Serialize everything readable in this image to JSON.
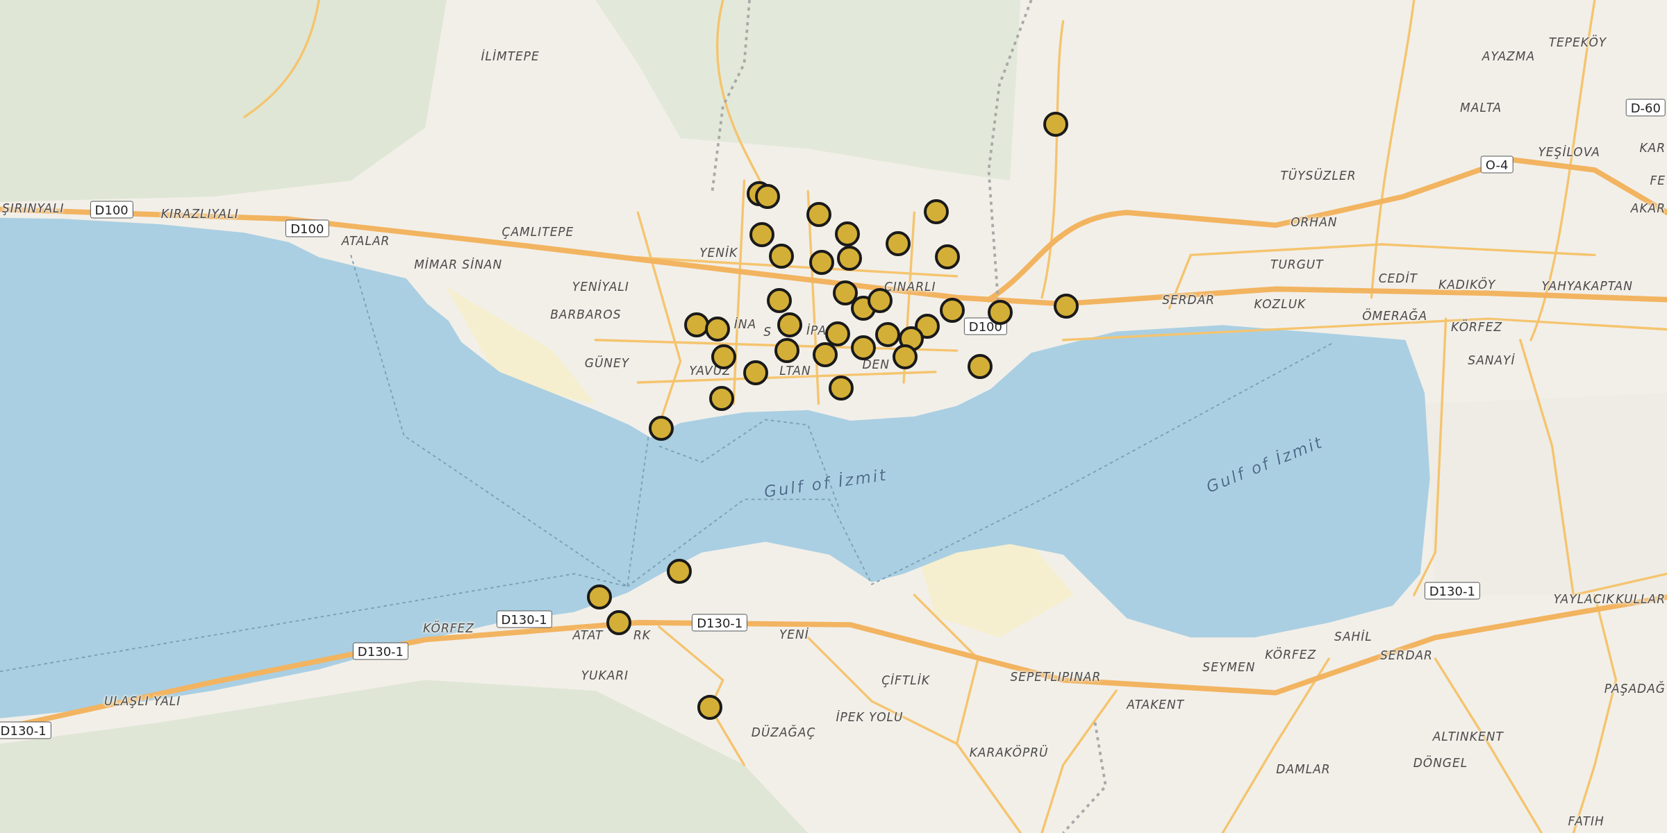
{
  "map": {
    "labels": [
      {
        "text": "İLİMTEPE",
        "kind": "place"
      },
      {
        "text": "AYAZMA",
        "kind": "place"
      },
      {
        "text": "TEPEKÖY",
        "kind": "place"
      },
      {
        "text": "MALTA",
        "kind": "place"
      },
      {
        "text": "D-60",
        "kind": "road_shield"
      },
      {
        "text": "TÜYSÜZLER",
        "kind": "place"
      },
      {
        "text": "O-4",
        "kind": "road_shield"
      },
      {
        "text": "YEŞİLOVA",
        "kind": "place"
      },
      {
        "text": "KAR",
        "kind": "place"
      },
      {
        "text": "FE",
        "kind": "place"
      },
      {
        "text": "ŞIRINYALI",
        "kind": "place"
      },
      {
        "text": "D100",
        "kind": "road_shield"
      },
      {
        "text": "KIRAZLIYALI",
        "kind": "place"
      },
      {
        "text": "AKAR",
        "kind": "place"
      },
      {
        "text": "D100",
        "kind": "road_shield"
      },
      {
        "text": "ATALAR",
        "kind": "place"
      },
      {
        "text": "ÇAMLITEPE",
        "kind": "place"
      },
      {
        "text": "ORHAN",
        "kind": "place"
      },
      {
        "text": "MİMAR SİNAN",
        "kind": "place"
      },
      {
        "text": "YENİK",
        "kind": "place"
      },
      {
        "text": "TURGUT",
        "kind": "place"
      },
      {
        "text": "YENİYALI",
        "kind": "place"
      },
      {
        "text": "ÇINARLI",
        "kind": "place"
      },
      {
        "text": "CEDİT",
        "kind": "place"
      },
      {
        "text": "KADIKÖY",
        "kind": "place"
      },
      {
        "text": "YAHYAKAPTAN",
        "kind": "place"
      },
      {
        "text": "BARBAROS",
        "kind": "place"
      },
      {
        "text": "İNA",
        "kind": "place"
      },
      {
        "text": "S",
        "kind": "place"
      },
      {
        "text": "İPA",
        "kind": "place"
      },
      {
        "text": "D100",
        "kind": "road_shield"
      },
      {
        "text": "SERDAR",
        "kind": "place"
      },
      {
        "text": "KOZLUK",
        "kind": "place"
      },
      {
        "text": "ÖMERAĞA",
        "kind": "place"
      },
      {
        "text": "KÖRFEZ",
        "kind": "place"
      },
      {
        "text": "GÜNEY",
        "kind": "place"
      },
      {
        "text": "YAVUZ",
        "kind": "place"
      },
      {
        "text": "LTAN",
        "kind": "place"
      },
      {
        "text": "DEN",
        "kind": "place"
      },
      {
        "text": "SANAYİ",
        "kind": "place"
      },
      {
        "text": "Gulf of İzmit",
        "kind": "water"
      },
      {
        "text": "Gulf of İzmit",
        "kind": "water"
      },
      {
        "text": "D130-1",
        "kind": "road_shield"
      },
      {
        "text": "YAYLACIK",
        "kind": "place"
      },
      {
        "text": "KULLAR",
        "kind": "place"
      },
      {
        "text": "KÖRFEZ",
        "kind": "place"
      },
      {
        "text": "D130-1",
        "kind": "road_shield"
      },
      {
        "text": "ATAT",
        "kind": "place"
      },
      {
        "text": "RK",
        "kind": "place"
      },
      {
        "text": "D130-1",
        "kind": "road_shield"
      },
      {
        "text": "YENİ",
        "kind": "place"
      },
      {
        "text": "SAHİL",
        "kind": "place"
      },
      {
        "text": "D130-1",
        "kind": "road_shield"
      },
      {
        "text": "KÖRFEZ",
        "kind": "place"
      },
      {
        "text": "SERDAR",
        "kind": "place"
      },
      {
        "text": "YUKARI",
        "kind": "place"
      },
      {
        "text": "ÇİFTLİK",
        "kind": "place"
      },
      {
        "text": "SEPETLIPINAR",
        "kind": "place"
      },
      {
        "text": "SEYMEN",
        "kind": "place"
      },
      {
        "text": "PAŞADAĞ",
        "kind": "place"
      },
      {
        "text": "ULAŞLI YALI",
        "kind": "place"
      },
      {
        "text": "ATAKENT",
        "kind": "place"
      },
      {
        "text": "İPEK YOLU",
        "kind": "place"
      },
      {
        "text": "D130-1",
        "kind": "road_shield"
      },
      {
        "text": "DÜZAĞAÇ",
        "kind": "place"
      },
      {
        "text": "ALTINKENT",
        "kind": "place"
      },
      {
        "text": "KARAKÖPRÜ",
        "kind": "place"
      },
      {
        "text": "DAMLAR",
        "kind": "place"
      },
      {
        "text": "DÖNGEL",
        "kind": "place"
      },
      {
        "text": "FATIH",
        "kind": "place"
      }
    ]
  }
}
